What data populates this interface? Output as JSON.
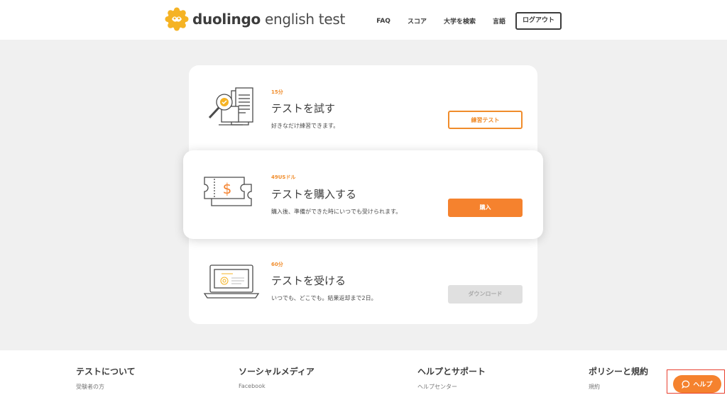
{
  "header": {
    "logo_text_bold": "duolingo",
    "logo_text": " english test",
    "nav": [
      "FAQ",
      "スコア",
      "大学を検索",
      "言語"
    ],
    "logout_label": "ログアウト"
  },
  "cards": [
    {
      "tag": "15分",
      "title": "テストを試す",
      "description": "好きなだけ練習できます。",
      "button": "練習テスト",
      "icon": "magnifier-document-icon"
    },
    {
      "tag": "49USドル",
      "title": "テストを購入する",
      "description": "購入後、準備ができた時にいつでも受けられます。",
      "button": "購入",
      "icon": "dollar-ticket-icon"
    },
    {
      "tag": "60分",
      "title": "テストを受ける",
      "description": "いつでも、どこでも。結果返却まで2日。",
      "button": "ダウンロード",
      "icon": "laptop-icon"
    }
  ],
  "footer": {
    "columns": [
      {
        "heading": "テストについて",
        "link": "受験者の方"
      },
      {
        "heading": "ソーシャルメディア",
        "link": "Facebook"
      },
      {
        "heading": "ヘルプとサポート",
        "link": "ヘルプセンター"
      },
      {
        "heading": "ポリシーと規約",
        "link": "規約"
      }
    ]
  },
  "help_button": "ヘルプ",
  "colors": {
    "accent": "#f5822e",
    "background": "#f0f0f0",
    "text": "#3c3c3c"
  }
}
